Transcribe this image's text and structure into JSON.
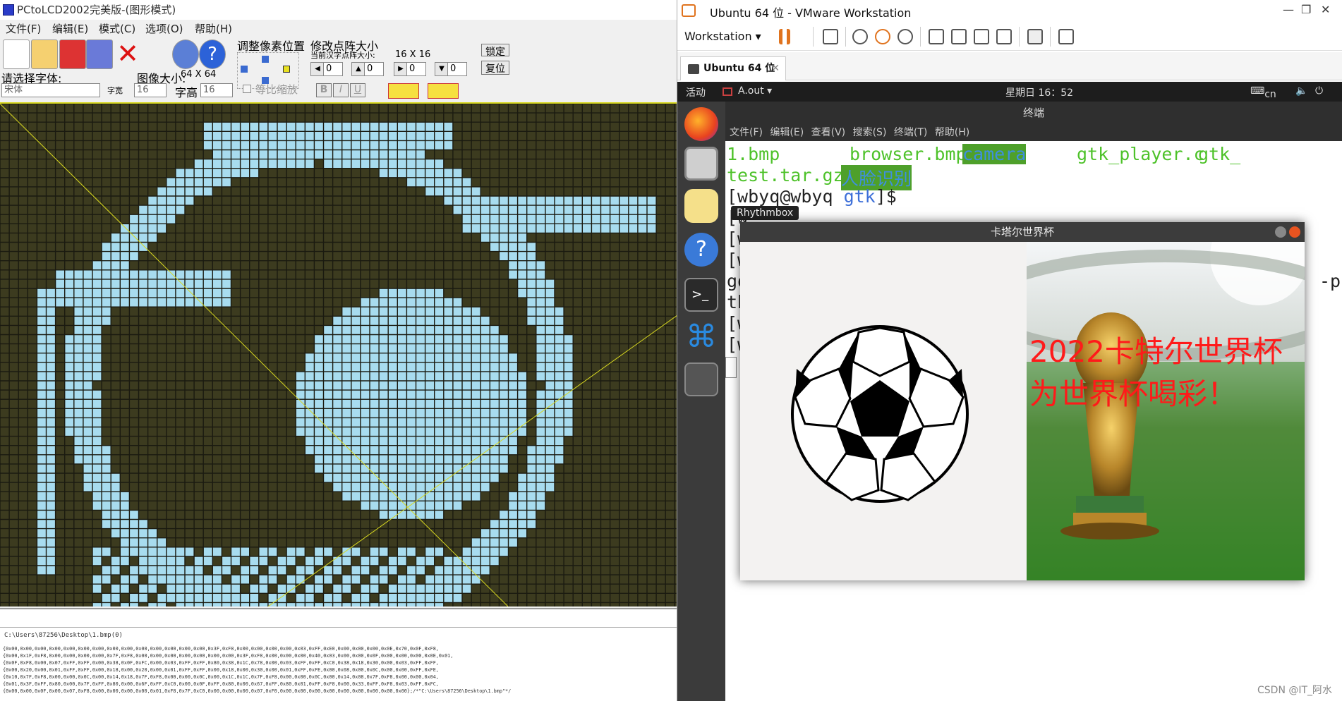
{
  "pcto": {
    "title": "PCtoLCD2002完美版-(图形模式)",
    "menu": [
      "文件(F)",
      "编辑(E)",
      "模式(C)",
      "选项(O)",
      "帮助(H)"
    ],
    "labels": {
      "font_select": "请选择字体:",
      "font_value": "宋体",
      "char_width": "字宽",
      "image_size": "图像大小:",
      "image_size_value": "64 X 64",
      "font_height": "字高",
      "w_value": "16",
      "h_value": "16",
      "proportional": "等比缩放",
      "adjust_pixel": "调整像素位置",
      "modify_matrix": "修改点阵大小",
      "current_matrix": "当前汉字点阵大小:",
      "matrix_value": "16 X 16",
      "lock": "锁定",
      "reset": "复位",
      "bold": "B",
      "italic": "I",
      "underline": "U",
      "spin_zero": "0"
    },
    "hex": {
      "path": "C:\\Users\\87256\\Desktop\\1.bmp(0)",
      "lines": [
        "{0x00,0x00,0x00,0x00,0x00,0x00,0x00,0x00,0x00,0x00,0x00,0x00,0x00,0x00,0x3F,0xF8,0x00,0x00,0x00,0x00,0x03,0xFF,0xE0,0x00,0x00,0x00,0x0E,0x70,0x0F,0xF8,",
        "{0x00,0x1F,0xF8,0x00,0x00,0x00,0x00,0x7F,0xF8,0x00,0x00,0x00,0x00,0x00,0x00,0x00,0x3F,0xF8,0x00,0x00,0x00,0x40,0x03,0x00,0x00,0x0F,0x00,0x00,0x00,0x0E,0x01,",
        "{0x0F,0xF8,0x00,0x07,0xFF,0xFF,0x00,0x38,0x0F,0xFC,0x00,0x03,0xFF,0xFF,0x80,0x38,0x1C,0x78,0x00,0x03,0xFF,0xFF,0xC0,0x38,0x18,0x30,0x00,0x03,0xFF,0xFF,",
        "{0x00,0x20,0x00,0x01,0xFF,0xFF,0x00,0x18,0x00,0x20,0x00,0x01,0xFF,0xFF,0x00,0x18,0x00,0x30,0x00,0x01,0xFF,0xFE,0x00,0x08,0x00,0x0C,0x00,0x00,0xFF,0xFE,",
        "{0x10,0x7F,0xF8,0x00,0x00,0x0C,0x00,0x14,0x18,0x7F,0xF8,0x00,0x00,0x0C,0x00,0x1C,0x1C,0x7F,0xF8,0x00,0x00,0x0C,0x00,0x14,0x08,0x7F,0xF8,0x00,0x00,0x04,",
        "{0x01,0x3F,0xFF,0x80,0x00,0x7F,0xFF,0x80,0x00,0x6F,0xFF,0xC0,0x00,0x0F,0xFF,0x80,0x00,0x67,0xFF,0x80,0x01,0xFF,0xF8,0x00,0x33,0xFF,0xF8,0x03,0xFF,0xFC,",
        "{0x00,0x00,0x0F,0x00,0x07,0xF8,0x00,0x00,0x00,0x00,0x01,0xF8,0x7F,0xC0,0x00,0x00,0x00,0x07,0xF0,0x00,0x00,0x00,0x00,0x00,0x00,0x00,0x00,0x00};/*\"C:\\Users\\87256\\Desktop\\1.bmp\"*/"
      ]
    }
  },
  "vmware": {
    "title": "Ubuntu 64 位 - VMware Workstation",
    "workstation_menu": "Workstation",
    "tab_label": "Ubuntu 64 位",
    "tab_close": "✕",
    "window_controls": [
      "—",
      "❐",
      "✕"
    ]
  },
  "ubuntu": {
    "activities": "活动",
    "app_menu": "A.out ▾",
    "clock": "星期日 16：52",
    "input_method": "cn",
    "tooltip": "Rhythmbox"
  },
  "terminal": {
    "title": "终端",
    "menu": "文件(F) 编辑(E) 查看(V) 搜索(S) 终端(T) 帮助(H)",
    "row1": [
      "1.bmp",
      "browser.bmp",
      "camera",
      "gtk_player.c",
      "gtk_"
    ],
    "row2": [
      "test.tar.gz",
      "人脸识别"
    ],
    "prompt_user": "[wbyq@wbyq",
    "prompt_dir": "gtk",
    "prompt_end": "]$",
    "partial_lines": [
      "[w",
      "[w",
      "[w",
      "go",
      "th",
      "[w",
      "[w"
    ],
    "right_fragment": "-p"
  },
  "gtk_window": {
    "title": "卡塔尔世界杯",
    "caption1": "2022卡特尔世界杯",
    "caption2": "为世界杯喝彩！"
  },
  "watermark": "CSDN @IT_阿水",
  "colors": {
    "grid_bg": "#3c3b1f",
    "grid_on": "#a8dcef",
    "grid_line": "#1a1a10",
    "terminal_green": "#4ec22a",
    "caption_red": "#ff1a1a"
  }
}
